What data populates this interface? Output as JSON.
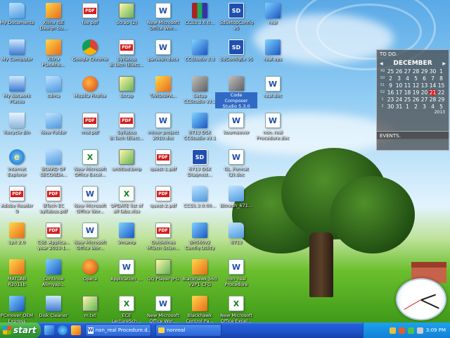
{
  "desktop": {
    "icons": [
      {
        "label": [
          "My Documents"
        ],
        "icon": "folder-icon",
        "type": "folder"
      },
      {
        "label": [
          "Xilinx ISE",
          "Design Su..."
        ],
        "icon": "app-icon",
        "type": "app"
      },
      {
        "label": [
          "fee pdf"
        ],
        "icon": "pdf-icon",
        "type": "pdf"
      },
      {
        "label": [
          "Scrap (2)"
        ],
        "icon": "document-icon",
        "type": "img"
      },
      {
        "label": [
          "New Microsoft",
          "Office Wor..."
        ],
        "icon": "word-icon",
        "type": "word"
      },
      {
        "label": [
          "CCS3.3.0.0..."
        ],
        "icon": "winrar-icon",
        "type": "rar"
      },
      {
        "label": [
          "SdSetupConfig",
          "v5"
        ],
        "icon": "sd-icon",
        "type": "sd"
      },
      {
        "label": [
          "real"
        ],
        "icon": "app-icon",
        "type": "app2"
      },
      {
        "label": [
          "My Computer"
        ],
        "icon": "computer-icon",
        "type": "comp"
      },
      {
        "label": [
          "Xilinx",
          "PlanAhe..."
        ],
        "icon": "app-icon",
        "type": "app"
      },
      {
        "label": [
          "Google Chrome"
        ],
        "icon": "chrome-icon",
        "type": "chrome"
      },
      {
        "label": [
          "Syllabus",
          "B.Tech (Elect..."
        ],
        "icon": "pdf-icon",
        "type": "pdf"
      },
      {
        "label": [
          "parvesh.docx"
        ],
        "icon": "word-icon",
        "type": "word"
      },
      {
        "label": [
          "CCStudio 3.3"
        ],
        "icon": "app-icon",
        "type": "app2"
      },
      {
        "label": [
          "SdConfigEx v5"
        ],
        "icon": "sd-icon",
        "type": "sd"
      },
      {
        "label": [
          "real.vps"
        ],
        "icon": "app-icon",
        "type": "app2"
      },
      {
        "label": [
          "My Network",
          "Places"
        ],
        "icon": "network-icon",
        "type": "comp"
      },
      {
        "label": [
          "cdma"
        ],
        "icon": "folder-icon",
        "type": "folder"
      },
      {
        "label": [
          "Mozilla Firefox"
        ],
        "icon": "firefox-icon",
        "type": "ff"
      },
      {
        "label": [
          "Scrap"
        ],
        "icon": "document-icon",
        "type": "img"
      },
      {
        "label": [
          "TARUNIPA..."
        ],
        "icon": "app-icon",
        "type": "app"
      },
      {
        "label": [
          "Setup",
          "CCStudio v3.3"
        ],
        "icon": "setup-icon",
        "type": "cube"
      },
      {
        "label": [
          "Code",
          "Composer",
          "Studio 5.3.0"
        ],
        "icon": "ccs-icon",
        "type": "cube"
      },
      {
        "label": [
          "real.doc"
        ],
        "icon": "word-icon",
        "type": "word"
      },
      {
        "label": [
          "Recycle Bin"
        ],
        "icon": "recycle-bin-icon",
        "type": "bin"
      },
      {
        "label": [
          "New Folder"
        ],
        "icon": "folder-icon",
        "type": "folder"
      },
      {
        "label": [
          "mul.pdf"
        ],
        "icon": "pdf-icon",
        "type": "pdf"
      },
      {
        "label": [
          "Syllabus",
          "B.Tech (Elect..."
        ],
        "icon": "pdf-icon",
        "type": "pdf"
      },
      {
        "label": [
          "minor project",
          "2010.doc"
        ],
        "icon": "word-icon",
        "type": "word"
      },
      {
        "label": [
          "6713 DSK",
          "CCStudio v3.1"
        ],
        "icon": "app-icon",
        "type": "app2"
      },
      {
        "label": [
          "kourneever"
        ],
        "icon": "word-icon",
        "type": "word"
      },
      {
        "label": [
          "non_real",
          "Procedure.doc"
        ],
        "icon": "word-icon",
        "type": "word"
      },
      {
        "label": [
          "Internet",
          "Explorer"
        ],
        "icon": "ie-icon",
        "type": "ie"
      },
      {
        "label": [
          "BOARD OF",
          "SECONDA..."
        ],
        "icon": "folder-icon",
        "type": "folder"
      },
      {
        "label": [
          "New Microsoft",
          "Office Excel..."
        ],
        "icon": "excel-icon",
        "type": "excel"
      },
      {
        "label": [
          "untitled.bmp"
        ],
        "icon": "image-icon",
        "type": "img"
      },
      {
        "label": [
          "quest-1.pdf"
        ],
        "icon": "pdf-icon",
        "type": "pdf"
      },
      {
        "label": [
          "6713 DSK",
          "Diagnost..."
        ],
        "icon": "sd-icon",
        "type": "sd"
      },
      {
        "label": [
          "GL_Format",
          "(2).doc"
        ],
        "icon": "word-icon",
        "type": "word"
      },
      {
        "label": [
          ""
        ],
        "icon": "none",
        "type": "none"
      },
      {
        "label": [
          "Adobe Reader",
          "9"
        ],
        "icon": "adobe-reader-icon",
        "type": "pdf"
      },
      {
        "label": [
          "BTech EC",
          "syllabus.pdf"
        ],
        "icon": "pdf-icon",
        "type": "pdf"
      },
      {
        "label": [
          "New Microsoft",
          "Office Wor..."
        ],
        "icon": "word-icon",
        "type": "word"
      },
      {
        "label": [
          "UPDATE list of",
          "all labs.xlsx"
        ],
        "icon": "excel-icon",
        "type": "excel"
      },
      {
        "label": [
          "quest-2.pdf"
        ],
        "icon": "pdf-icon",
        "type": "pdf"
      },
      {
        "label": [
          "CCS5.3.0.00..."
        ],
        "icon": "folder-icon",
        "type": "folder"
      },
      {
        "label": [
          "Bitnesh_671..."
        ],
        "icon": "folder-icon",
        "type": "folder"
      },
      {
        "label": [
          ""
        ],
        "icon": "none",
        "type": "none"
      },
      {
        "label": [
          "LyX 2.0"
        ],
        "icon": "lyx-icon",
        "type": "app"
      },
      {
        "label": [
          "CSE_Applica...",
          "year 2013-1..."
        ],
        "icon": "pdf-icon",
        "type": "pdf"
      },
      {
        "label": [
          "New Microsoft",
          "Office Wor..."
        ],
        "icon": "word-icon",
        "type": "word"
      },
      {
        "label": [
          "Vmamp"
        ],
        "icon": "app-icon",
        "type": "app2"
      },
      {
        "label": [
          "Guidelines",
          "MTech Scien..."
        ],
        "icon": "pdf-icon",
        "type": "pdf"
      },
      {
        "label": [
          "BH560v2",
          "Config Utility"
        ],
        "icon": "app-icon",
        "type": "app2"
      },
      {
        "label": [
          "6713"
        ],
        "icon": "folder-icon",
        "type": "folder"
      },
      {
        "label": [
          ""
        ],
        "icon": "none",
        "type": "none"
      },
      {
        "label": [
          "MATLAB",
          "R2011b"
        ],
        "icon": "matlab-icon",
        "type": "app"
      },
      {
        "label": [
          "Continue",
          "Alimyap..."
        ],
        "icon": "app-icon",
        "type": "app2"
      },
      {
        "label": [
          "Opera"
        ],
        "icon": "opera-icon",
        "type": "ff"
      },
      {
        "label": [
          "Application_..."
        ],
        "icon": "word-icon",
        "type": "word"
      },
      {
        "label": [
          "QQ Player JPG"
        ],
        "icon": "image-icon",
        "type": "img"
      },
      {
        "label": [
          "Blackhawk 560",
          "V2P1 CFG"
        ],
        "icon": "app-icon",
        "type": "app"
      },
      {
        "label": [
          "non_real",
          "Procedure"
        ],
        "icon": "word-icon",
        "type": "word"
      },
      {
        "label": [
          ""
        ],
        "icon": "none",
        "type": "none"
      },
      {
        "label": [
          "PCmover OEM",
          "Express"
        ],
        "icon": "pcmover-icon",
        "type": "app2"
      },
      {
        "label": [
          "Disk Cleaner"
        ],
        "icon": "disk-cleaner-icon",
        "type": "comp"
      },
      {
        "label": [
          "m.txt"
        ],
        "icon": "text-file-icon",
        "type": "img"
      },
      {
        "label": [
          "ECE",
          "LectureSch..."
        ],
        "icon": "excel-icon",
        "type": "excel"
      },
      {
        "label": [
          "New Microsoft",
          "Office Wor..."
        ],
        "icon": "word-icon",
        "type": "word"
      },
      {
        "label": [
          "Blackhawk",
          "Control Pa..."
        ],
        "icon": "app-icon",
        "type": "app"
      },
      {
        "label": [
          "New Microsoft",
          "Office Excel..."
        ],
        "icon": "excel-icon",
        "type": "excel"
      },
      {
        "label": [
          ""
        ],
        "icon": "none",
        "type": "none"
      }
    ],
    "selected_index": 22
  },
  "todo": {
    "title": "TO DO.",
    "month": "DECEMBER",
    "prev": "◀",
    "next": "▶",
    "weeks": [
      {
        "wk": "49",
        "days": [
          "25",
          "26",
          "27",
          "28",
          "29",
          "30",
          "1"
        ]
      },
      {
        "wk": "50",
        "days": [
          "2",
          "3",
          "4",
          "5",
          "6",
          "7",
          "8"
        ]
      },
      {
        "wk": "51",
        "days": [
          "9",
          "10",
          "11",
          "12",
          "13",
          "14",
          "15"
        ]
      },
      {
        "wk": "52",
        "days": [
          "16",
          "17",
          "18",
          "19",
          "20",
          "21",
          "22"
        ]
      },
      {
        "wk": "1",
        "days": [
          "23",
          "24",
          "25",
          "26",
          "27",
          "28",
          "29"
        ]
      },
      {
        "wk": "2",
        "days": [
          "30",
          "31",
          "1",
          "2",
          "3",
          "4",
          "5"
        ]
      }
    ],
    "today": "21",
    "year": "2013",
    "events_title": "EVENTS."
  },
  "taskbar": {
    "start_label": "start",
    "tasks": [
      {
        "label": "non_real Procedure.d...",
        "icon": "word-icon"
      },
      {
        "label": "nonreal",
        "icon": "folder-icon"
      }
    ],
    "time": "3:09 PM"
  },
  "colors": {
    "selected": "#316ac5",
    "taskbar": "#245edb",
    "start": "#3b9c3b",
    "today": "#d01c1c"
  }
}
